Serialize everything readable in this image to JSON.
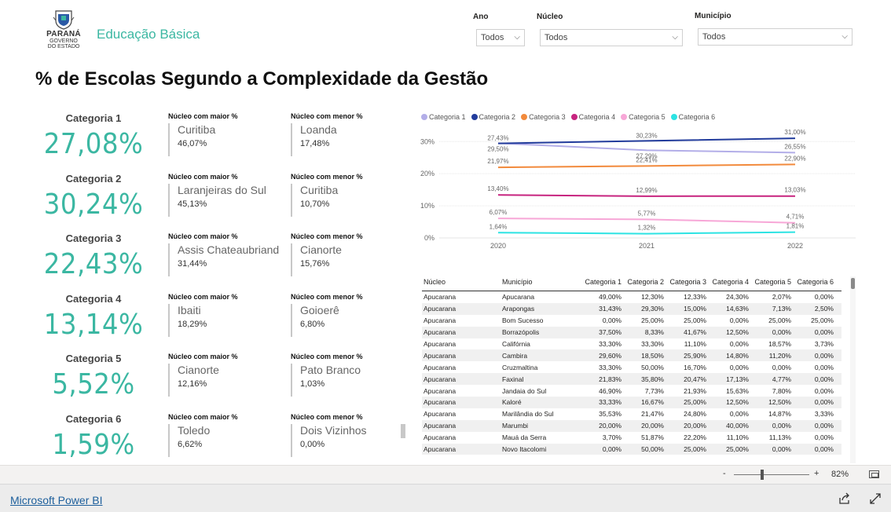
{
  "header": {
    "logo_line1": "PARANÁ",
    "logo_line2": "GOVERNO",
    "logo_line3": "DO ESTADO",
    "app_title": "Educação Básica"
  },
  "filters": {
    "ano": {
      "label": "Ano",
      "value": "Todos"
    },
    "nucleo": {
      "label": "Núcleo",
      "value": "Todos"
    },
    "municipio": {
      "label": "Município",
      "value": "Todos"
    }
  },
  "page_title": "% de Escolas Segundo a Complexidade da Gestão",
  "categories": [
    {
      "name": "Categoria 1",
      "value": "27,08%",
      "max_head": "Núcleo com maior %",
      "max_name": "Curitiba",
      "max_pct": "46,07%",
      "min_head": "Núcleo com menor %",
      "min_name": "Loanda",
      "min_pct": "17,48%"
    },
    {
      "name": "Categoria 2",
      "value": "30,24%",
      "max_head": "Núcleo com maior %",
      "max_name": "Laranjeiras do Sul",
      "max_pct": "45,13%",
      "min_head": "Núcleo com menor %",
      "min_name": "Curitiba",
      "min_pct": "10,70%"
    },
    {
      "name": "Categoria 3",
      "value": "22,43%",
      "max_head": "Núcleo com maior %",
      "max_name": "Assis Chateaubriand",
      "max_pct": "31,44%",
      "min_head": "Núcleo com menor %",
      "min_name": "Cianorte",
      "min_pct": "15,76%"
    },
    {
      "name": "Categoria 4",
      "value": "13,14%",
      "max_head": "Núcleo com maior %",
      "max_name": "Ibaiti",
      "max_pct": "18,29%",
      "min_head": "Núcleo com menor %",
      "min_name": "Goioerê",
      "min_pct": "6,80%"
    },
    {
      "name": "Categoria 5",
      "value": "5,52%",
      "max_head": "Núcleo com maior %",
      "max_name": "Cianorte",
      "max_pct": "12,16%",
      "min_head": "Núcleo com menor %",
      "min_name": "Pato Branco",
      "min_pct": "1,03%"
    },
    {
      "name": "Categoria 6",
      "value": "1,59%",
      "max_head": "Núcleo com maior %",
      "max_name": "Toledo",
      "max_pct": "6,62%",
      "min_head": "Núcleo com menor %",
      "min_name": "Dois Vizinhos",
      "min_pct": "0,00%"
    }
  ],
  "chart_data": {
    "type": "line",
    "x": [
      "2020",
      "2021",
      "2022"
    ],
    "ylim": [
      0,
      33
    ],
    "yticks": [
      "0%",
      "10%",
      "20%",
      "30%"
    ],
    "ytick_values": [
      0,
      10,
      20,
      30
    ],
    "legend_position": "top-left",
    "grid": true,
    "series": [
      {
        "name": "Categoria 1",
        "color": "#b3aee8",
        "values": [
          29.5,
          27.29,
          26.55
        ],
        "labels": [
          "29,50%",
          "27,29%",
          "26,55%"
        ]
      },
      {
        "name": "Categoria 2",
        "color": "#223c9c",
        "values": [
          29.43,
          30.23,
          31.0
        ],
        "labels": [
          "27,43%",
          "30,23%",
          "31,00%"
        ]
      },
      {
        "name": "Categoria 3",
        "color": "#f28a3c",
        "values": [
          21.97,
          22.41,
          22.9
        ],
        "labels": [
          "21,97%",
          "22,41%",
          "22,90%"
        ]
      },
      {
        "name": "Categoria 4",
        "color": "#c7247f",
        "values": [
          13.4,
          12.99,
          13.03
        ],
        "labels": [
          "13,40%",
          "12,99%",
          "13,03%"
        ]
      },
      {
        "name": "Categoria 5",
        "color": "#f7a7d7",
        "values": [
          6.07,
          5.77,
          4.71
        ],
        "labels": [
          "6,07%",
          "5,77%",
          "4,71%"
        ]
      },
      {
        "name": "Categoria 6",
        "color": "#2de3e3",
        "values": [
          1.64,
          1.32,
          1.81
        ],
        "labels": [
          "1,64%",
          "1,32%",
          "1,81%"
        ]
      }
    ]
  },
  "table": {
    "headers": [
      "Núcleo",
      "Município",
      "Categoria 1",
      "Categoria 2",
      "Categoria 3",
      "Categoria 4",
      "Categoria 5",
      "Categoria 6"
    ],
    "rows": [
      [
        "Apucarana",
        "Apucarana",
        "49,00%",
        "12,30%",
        "12,33%",
        "24,30%",
        "2,07%",
        "0,00%"
      ],
      [
        "Apucarana",
        "Arapongas",
        "31,43%",
        "29,30%",
        "15,00%",
        "14,63%",
        "7,13%",
        "2,50%"
      ],
      [
        "Apucarana",
        "Bom Sucesso",
        "0,00%",
        "25,00%",
        "25,00%",
        "0,00%",
        "25,00%",
        "25,00%"
      ],
      [
        "Apucarana",
        "Borrazópolis",
        "37,50%",
        "8,33%",
        "41,67%",
        "12,50%",
        "0,00%",
        "0,00%"
      ],
      [
        "Apucarana",
        "Califórnia",
        "33,30%",
        "33,30%",
        "11,10%",
        "0,00%",
        "18,57%",
        "3,73%"
      ],
      [
        "Apucarana",
        "Cambira",
        "29,60%",
        "18,50%",
        "25,90%",
        "14,80%",
        "11,20%",
        "0,00%"
      ],
      [
        "Apucarana",
        "Cruzmaltina",
        "33,30%",
        "50,00%",
        "16,70%",
        "0,00%",
        "0,00%",
        "0,00%"
      ],
      [
        "Apucarana",
        "Faxinal",
        "21,83%",
        "35,80%",
        "20,47%",
        "17,13%",
        "4,77%",
        "0,00%"
      ],
      [
        "Apucarana",
        "Jandaia do Sul",
        "46,90%",
        "7,73%",
        "21,93%",
        "15,63%",
        "7,80%",
        "0,00%"
      ],
      [
        "Apucarana",
        "Kaloré",
        "33,33%",
        "16,67%",
        "25,00%",
        "12,50%",
        "12,50%",
        "0,00%"
      ],
      [
        "Apucarana",
        "Marilândia do Sul",
        "35,53%",
        "21,47%",
        "24,80%",
        "0,00%",
        "14,87%",
        "3,33%"
      ],
      [
        "Apucarana",
        "Marumbi",
        "20,00%",
        "20,00%",
        "20,00%",
        "40,00%",
        "0,00%",
        "0,00%"
      ],
      [
        "Apucarana",
        "Mauá da Serra",
        "3,70%",
        "51,87%",
        "22,20%",
        "11,10%",
        "11,13%",
        "0,00%"
      ],
      [
        "Apucarana",
        "Novo Itacolomi",
        "0,00%",
        "50,00%",
        "25,00%",
        "25,00%",
        "0,00%",
        "0,00%"
      ]
    ]
  },
  "zoom": {
    "minus": "-",
    "plus": "+",
    "value": "82%"
  },
  "footer": {
    "link": "Microsoft Power BI"
  }
}
